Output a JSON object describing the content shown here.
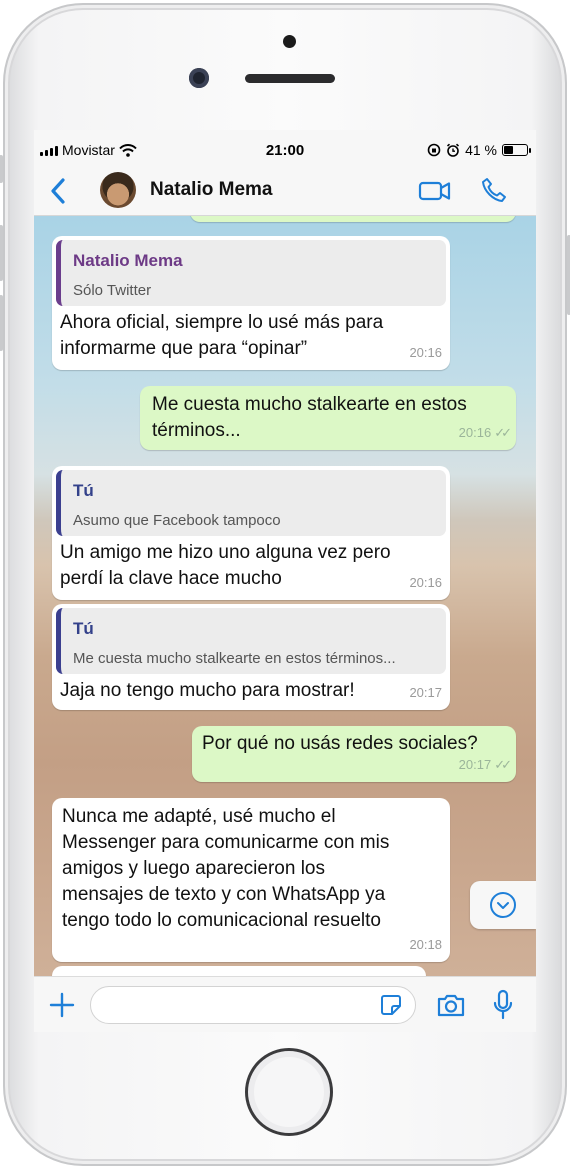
{
  "status_bar": {
    "carrier": "Movistar",
    "time": "21:00",
    "battery": "41 %",
    "battery_level": 0.41
  },
  "header": {
    "contact_name": "Natalio Mema",
    "icons": [
      "back-chevron-icon",
      "video-call-icon",
      "voice-call-icon"
    ]
  },
  "messages": [
    {
      "direction": "in",
      "quote_author": "Natalio Mema",
      "quote_text": "Sólo Twitter",
      "line1": "Ahora oficial, siempre lo usé más para",
      "line2": "informarme que para “opinar”",
      "time": "20:16"
    },
    {
      "direction": "out",
      "line1": "Me cuesta mucho stalkearte en estos",
      "line2": "términos...",
      "time": "20:16"
    },
    {
      "direction": "in",
      "quote_author": "Tú",
      "quote_text": "Asumo que Facebook tampoco",
      "line1": "Un amigo me hizo uno alguna vez pero",
      "line2": "perdí la clave hace mucho",
      "time": "20:16"
    },
    {
      "direction": "in",
      "quote_author": "Tú",
      "quote_text": "Me cuesta mucho stalkearte en estos términos...",
      "line1": "Jaja no tengo mucho para mostrar!",
      "time": "20:17"
    },
    {
      "direction": "out",
      "line1": "Por qué no usás redes sociales?",
      "time": "20:17"
    },
    {
      "direction": "in",
      "line1": "Nunca me adapté, usé mucho el",
      "line2": "Messenger para comunicarme con mis",
      "line3": "amigos y luego aparecieron los",
      "line4": "mensajes de texto y con WhatsApp ya",
      "line5": "tengo todo lo comunicacional resuelto",
      "time": "20:18"
    }
  ],
  "input_bar": {
    "icons": [
      "plus-icon",
      "sticker-icon",
      "camera-icon",
      "microphone-icon"
    ]
  },
  "colors": {
    "accent": "#1e7fd8",
    "outgoing_bubble": "#dcf8c6",
    "incoming_bubble": "#ffffff",
    "quote_author_contact": "#6d3a86",
    "quote_author_self": "#33418a"
  }
}
